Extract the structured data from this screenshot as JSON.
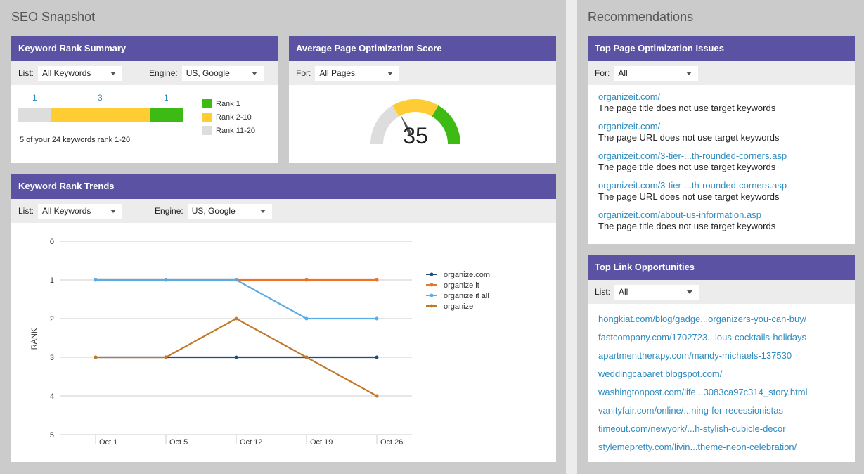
{
  "left_title": "SEO Snapshot",
  "right_title": "Recommendations",
  "colors": {
    "header": "#5b52a3",
    "green": "#3dbb14",
    "yellow": "#ffcc33",
    "gray": "#dddddd",
    "link": "#2e8bbf"
  },
  "keyword_rank_summary": {
    "title": "Keyword Rank Summary",
    "list_label": "List:",
    "list_value": "All Keywords",
    "engine_label": "Engine:",
    "engine_value": "US, Google",
    "counts": [
      "1",
      "3",
      "1"
    ],
    "bar_fractions": {
      "rank_11_20": 0.2,
      "rank_2_10": 0.6,
      "rank_1": 0.2
    },
    "legend": [
      "Rank 1",
      "Rank 2-10",
      "Rank 11-20"
    ],
    "summary": "5 of your 24 keywords rank 1-20"
  },
  "page_optimization": {
    "title": "Average Page Optimization Score",
    "for_label": "For:",
    "for_value": "All Pages",
    "score": "35",
    "score_value": 35
  },
  "keyword_rank_trends": {
    "title": "Keyword Rank Trends",
    "list_label": "List:",
    "list_value": "All Keywords",
    "engine_label": "Engine:",
    "engine_value": "US, Google"
  },
  "chart_data": {
    "type": "line",
    "ylabel": "RANK",
    "xlabel": "",
    "ylim": [
      0,
      5
    ],
    "y_inverted": true,
    "y_ticks": [
      "0",
      "1",
      "2",
      "3",
      "4",
      "5"
    ],
    "categories": [
      "Oct 1",
      "Oct 5",
      "Oct 12",
      "Oct 19",
      "Oct 26"
    ],
    "legend_position": "right",
    "grid": true,
    "series": [
      {
        "name": "organize.com",
        "color": "#1f4e79",
        "values": [
          3,
          3,
          3,
          3,
          3
        ]
      },
      {
        "name": "organize it",
        "color": "#f07227",
        "values": [
          1,
          1,
          1,
          1,
          1
        ]
      },
      {
        "name": "organize it all",
        "color": "#5aade6",
        "values": [
          1,
          1,
          1,
          2,
          2
        ]
      },
      {
        "name": "organize",
        "color": "#c0792c",
        "values": [
          3,
          3,
          2,
          3,
          4
        ]
      }
    ]
  },
  "top_issues": {
    "title": "Top Page Optimization Issues",
    "for_label": "For:",
    "for_value": "All",
    "items": [
      {
        "url": "organizeit.com/",
        "issue": "The page title does not use target keywords"
      },
      {
        "url": "organizeit.com/",
        "issue": "The page URL does not use target keywords"
      },
      {
        "url": "organizeit.com/3-tier-...th-rounded-corners.asp",
        "issue": "The page title does not use target keywords"
      },
      {
        "url": "organizeit.com/3-tier-...th-rounded-corners.asp",
        "issue": "The page URL does not use target keywords"
      },
      {
        "url": "organizeit.com/about-us-information.asp",
        "issue": "The page title does not use target keywords"
      }
    ]
  },
  "top_links": {
    "title": "Top Link Opportunities",
    "list_label": "List:",
    "list_value": "All",
    "items": [
      "hongkiat.com/blog/gadge...organizers-you-can-buy/",
      "fastcompany.com/1702723...ious-cocktails-holidays",
      "apartmenttherapy.com/mandy-michaels-137530",
      "weddingcabaret.blogspot.com/",
      "washingtonpost.com/life...3083ca97c314_story.html",
      "vanityfair.com/online/...ning-for-recessionistas",
      "timeout.com/newyork/...h-stylish-cubicle-decor",
      "stylemepretty.com/livin...theme-neon-celebration/"
    ]
  }
}
